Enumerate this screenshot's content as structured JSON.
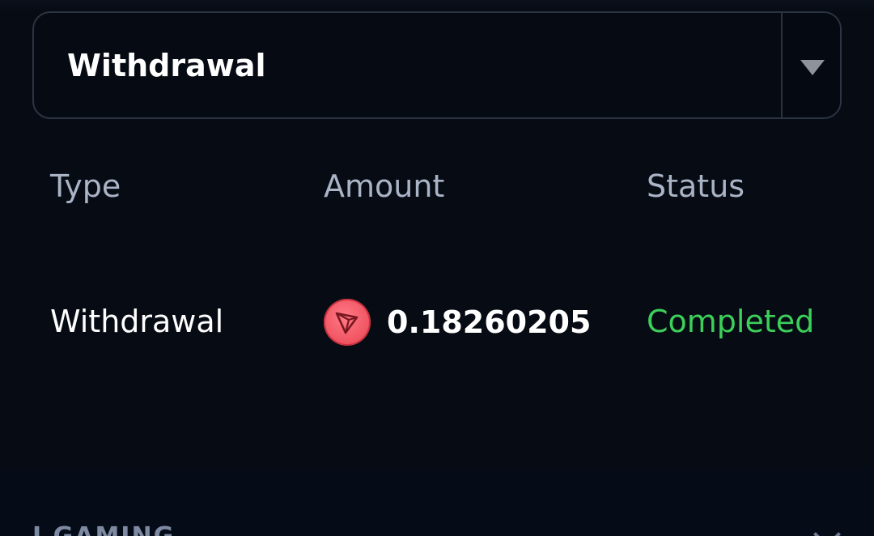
{
  "filter": {
    "selected": "Withdrawal",
    "arrow_icon": "chevron-down-icon"
  },
  "table": {
    "headers": {
      "type": "Type",
      "amount": "Amount",
      "status": "Status"
    },
    "rows": [
      {
        "type": "Withdrawal",
        "currency_icon": "tron-coin-icon",
        "amount": "0.18260205",
        "status": "Completed"
      }
    ]
  },
  "footer": {
    "label": "I GAMING",
    "icon": "chevron-down-icon"
  },
  "colors": {
    "status_completed": "#3ccf5a",
    "coin": "#e8404f",
    "background": "#070b14"
  }
}
